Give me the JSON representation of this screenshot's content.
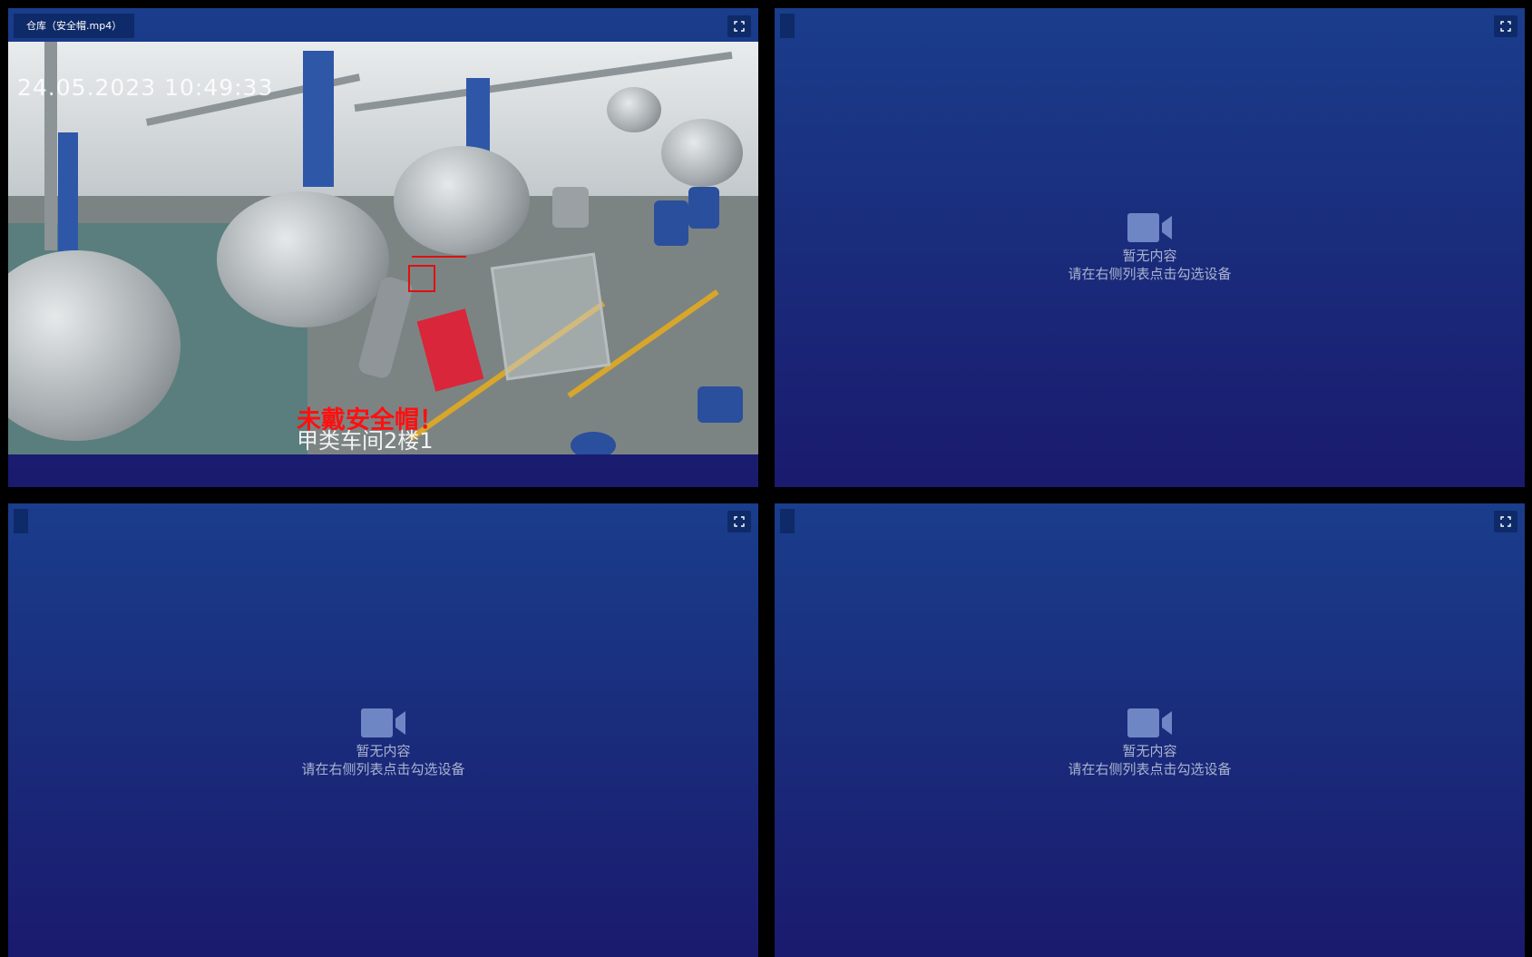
{
  "panels": [
    {
      "title": "仓库（安全帽.mp4）",
      "video": {
        "timestamp": "24.05.2023 10:49:33",
        "alarm_text": "未戴安全帽！",
        "location_text": "甲类车间2楼1"
      }
    },
    {
      "placeholder": {
        "line1": "暂无内容",
        "line2": "请在右侧列表点击勾选设备"
      }
    },
    {
      "placeholder": {
        "line1": "暂无内容",
        "line2": "请在右侧列表点击勾选设备"
      }
    },
    {
      "placeholder": {
        "line1": "暂无内容",
        "line2": "请在右侧列表点击勾选设备"
      }
    }
  ],
  "icons": {
    "expand": "fullscreen-icon",
    "camera": "video-camera-icon"
  },
  "colors": {
    "panel_top": "#1a3d8c",
    "panel_bottom": "#1a1a6e",
    "alarm": "#ff1010"
  }
}
